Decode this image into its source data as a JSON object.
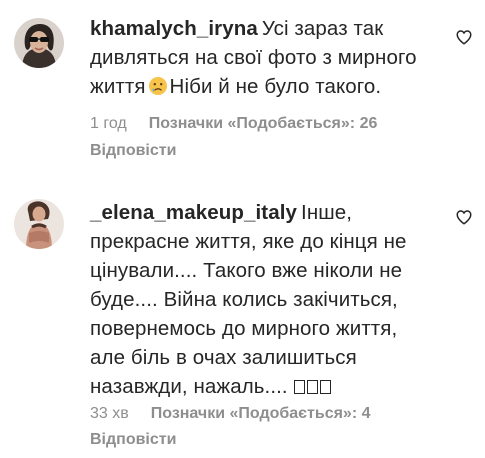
{
  "comments": [
    {
      "username": "khamalych_iryna",
      "text_before_emoji": "Усі зараз так дивляться на свої фото з мирного життя",
      "emoji": "sad-face",
      "text_after_emoji": "Ніби й не було такого.",
      "time": "1 год",
      "likes": "Позначки «Подобається»: 26",
      "reply_label": "Відповісти"
    },
    {
      "username": "_elena_makeup_italy",
      "text": "Інше, прекрасне життя, яке до кінця не цінували.... Такого вже ніколи не буде.... Війна колись закічиться, повернемось до мирного життя, але біль в очах залишиться назавжди, нажаль....",
      "trailing_glyphs": 3,
      "time": "33 хв",
      "likes": "Позначки «Подобається»: 4",
      "reply_label": "Відповісти"
    }
  ],
  "icons": {
    "like": "heart-outline-icon"
  },
  "colors": {
    "text": "#262626",
    "secondary": "#8e8e8e"
  }
}
